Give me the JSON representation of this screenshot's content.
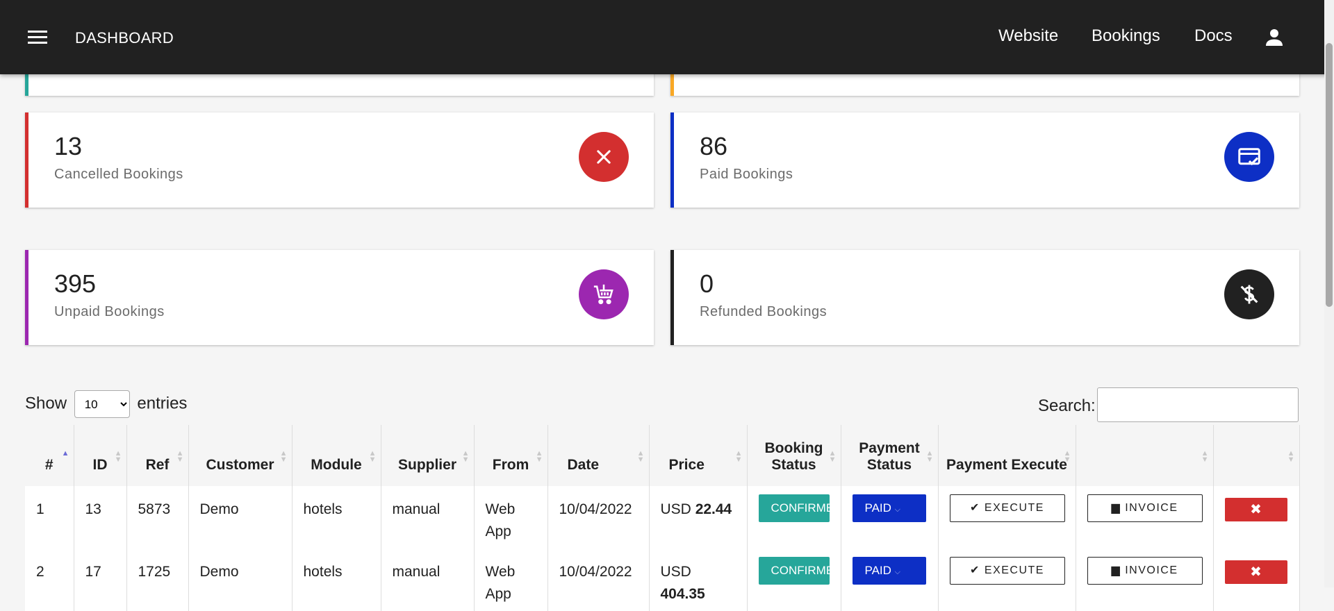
{
  "topbar": {
    "brand": "DASHBOARD",
    "nav": [
      "Website",
      "Bookings",
      "Docs"
    ]
  },
  "stats": {
    "cancelled": {
      "value": "13",
      "label": "Cancelled Bookings",
      "color": "#d32f2f",
      "icon": "close-icon"
    },
    "paid": {
      "value": "86",
      "label": "Paid Bookings",
      "color": "#0d2fc5",
      "icon": "paid-card-icon"
    },
    "unpaid": {
      "value": "395",
      "label": "Unpaid Bookings",
      "color": "#9c27b0",
      "icon": "cart-icon"
    },
    "refunded": {
      "value": "0",
      "label": "Refunded Bookings",
      "color": "#212121",
      "icon": "money-off-icon"
    }
  },
  "table_controls": {
    "show_label": "Show",
    "entries_value": "10",
    "entries_label": "entries",
    "search_label": "Search:",
    "search_value": ""
  },
  "table": {
    "headers": [
      "#",
      "ID",
      "Ref",
      "Customer",
      "Module",
      "Supplier",
      "From",
      "Date",
      "Price",
      "Booking Status",
      "Payment Status",
      "Payment Execute",
      "",
      ""
    ],
    "rows": [
      {
        "n": "1",
        "id": "13",
        "ref": "5873",
        "customer": "Demo",
        "module": "hotels",
        "supplier": "manual",
        "from": "Web App",
        "date": "10/04/2022",
        "currency": "USD",
        "amount": "22.44",
        "booking_status": "CONFIRMED",
        "payment_status": "PAID",
        "execute": "EXECUTE",
        "invoice": "INVOICE",
        "delete": "✖"
      },
      {
        "n": "2",
        "id": "17",
        "ref": "1725",
        "customer": "Demo",
        "module": "hotels",
        "supplier": "manual",
        "from": "Web App",
        "date": "10/04/2022",
        "currency": "USD",
        "amount": "404.35",
        "booking_status": "CONFIRMED",
        "payment_status": "PAID",
        "execute": "EXECUTE",
        "invoice": "INVOICE",
        "delete": "✖"
      }
    ]
  }
}
